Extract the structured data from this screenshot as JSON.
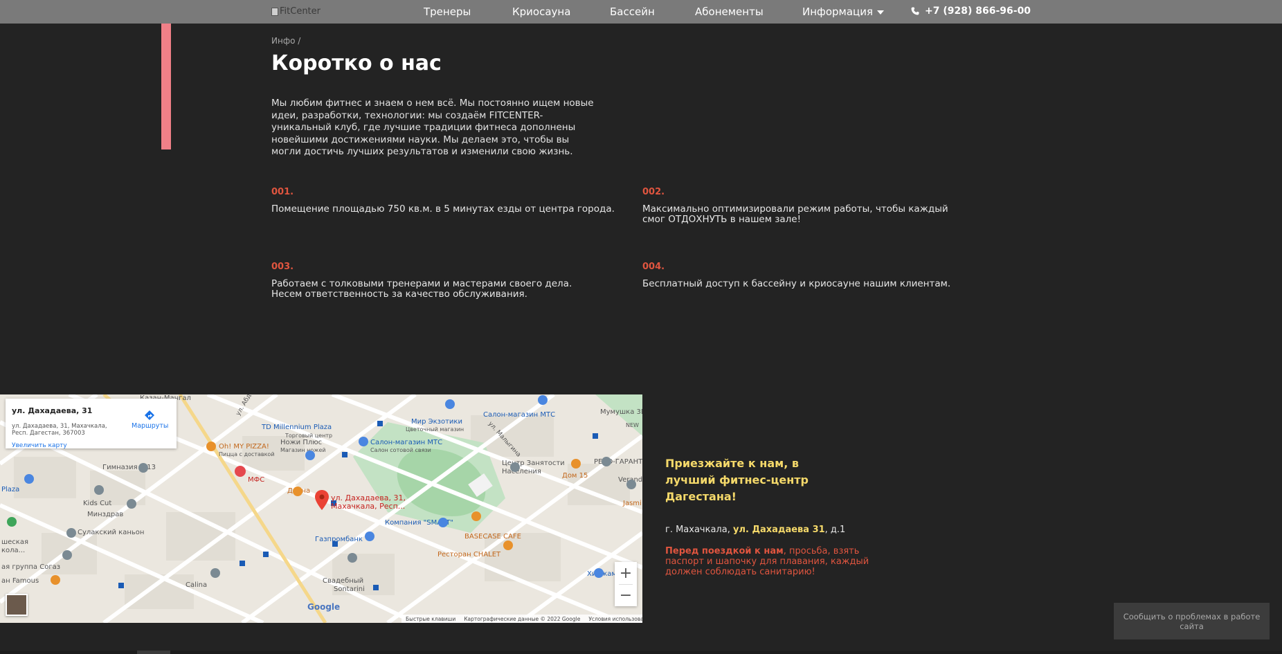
{
  "header": {
    "logo_alt": "FitCenter",
    "nav": [
      "Тренеры",
      "Криосауна",
      "Бассейн",
      "Абонементы",
      "Информация"
    ],
    "phone": "+7 (928) 866-96-00"
  },
  "breadcrumb": "Инфо /",
  "title": "Коротко о нас",
  "intro": "Мы любим фитнес и знаем о нем всё. Мы постоянно ищем новые идеи, разработки, технологии: мы создаём FITCENTER-уникальный клуб, где лучшие традиции фитнеса дополнены новейшими достижениями науки. Мы делаем это, чтобы вы могли достичь лучших результатов и изменили свою жизнь.",
  "features": [
    {
      "num": "001.",
      "text": "Помещение площадью 750 кв.м. в 5 минутах езды от центра города."
    },
    {
      "num": "002.",
      "text": "Максимально оптимизировали режим работы, чтобы каждый смог ОТДОХНУТЬ в нашем зале!"
    },
    {
      "num": "003.",
      "text": "Работаем с толковыми тренерами и мастерами своего дела. Несем ответственность за качество обслуживания."
    },
    {
      "num": "004.",
      "text": "Бесплатный доступ к бассейну и криосауне нашим клиентам."
    }
  ],
  "map": {
    "card_title": "ул. Дахадаева, 31",
    "card_address": "ул. Дахадаева, 31, Махачкала, Респ. Дагестан, 367003",
    "routes_label": "Маршруты",
    "enlarge_label": "Увеличить карту",
    "pin_label_1": "ул. Дахадаева, 31,",
    "pin_label_2": "Махачкала, Респ...",
    "zoom_in": "+",
    "zoom_out": "−",
    "google": "Google",
    "footer": [
      "Быстрые клавиши",
      "Картографические данные © 2022 Google",
      "Условия использования"
    ],
    "labels": {
      "kazan_mangal": "Казан-Мангал",
      "td_millennium": "TD Millennium Plaza",
      "td_sub": "Торговый центр",
      "mir_exotiki": "Мир Экзотики",
      "mir_sub": "Цветочный магазин",
      "salon_mts_1": "Салон-магазин МТС",
      "salon_mts_2": "Салон-магазин МТС",
      "salon_sub": "Салон сотовой связи",
      "mumushka": "Мумушка 3D",
      "oh_my_pizza": "Oh! MY PIZZA!",
      "pizza_sub": "Пицца с доставкой",
      "nozhi": "Ножи Плюс",
      "nozhi_sub": "Магазин ножей",
      "gimnaziya": "Гимназия №13",
      "mfc": "МФС",
      "centr": "Центр Занятости",
      "centr2": "Населения",
      "dom15": "Дом 15",
      "reso": "РЕСО-ГАРАНТ",
      "verandi": "Verandi",
      "plaza": "Plaza",
      "kids_cut": "Kids Cut",
      "minzdrav": "Минздрав",
      "diana": "Диана",
      "jasmin": "Jasmi",
      "sulak": "Сулакский каньон",
      "shkola1": "шеская",
      "shkola2": "кола...",
      "kompaniya": "Компания \"SMART\"",
      "basecase": "BASECASE CAFE",
      "gazprombank": "Газпромбанк",
      "restoran": "Ресторан CHALET",
      "sogaz": "ая группа Согаз",
      "khidzhama": "Хиджама",
      "famous": "ан Famous",
      "calina": "Calina",
      "svadebny": "Свадебный",
      "sontarini": "Sontarini",
      "ul_abd": "ул. Абд",
      "ul_malygina": "ул. Малыгина",
      "nizh": "NEW"
    }
  },
  "cta": "Приезжайте к нам, в лучший фитнес-центр Дагестана!",
  "address": {
    "city": "г. Махачкала,",
    "street": "ул. Дахадаева 31",
    "rest": ", д.1"
  },
  "note": {
    "bold": "Перед поездкой к нам",
    "text": ", просьба, взять паспорт и шапочку для плавания, каждый должен соблюдать санитарию!"
  },
  "report": "Сообщить о проблемах в работе сайта",
  "colors": {
    "accent": "#f08088",
    "number": "#e0553f",
    "highlight": "#f5d96a",
    "background": "#232323"
  }
}
